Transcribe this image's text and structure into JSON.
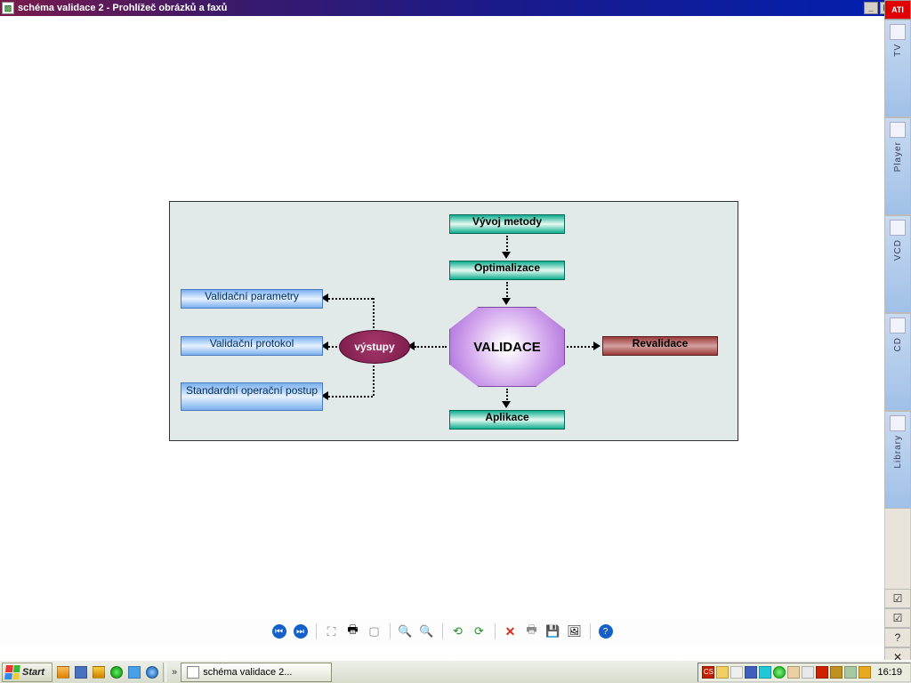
{
  "window": {
    "title": "schéma validace 2 - Prohlížeč obrázků a faxů"
  },
  "ati_sidebar": {
    "logo": "ATI",
    "items": [
      "TV",
      "Player",
      "VCD",
      "CD",
      "Library"
    ],
    "mini": [
      "☑",
      "☑",
      "?",
      "✕"
    ]
  },
  "diagram": {
    "top1": "Vývoj metody",
    "top2": "Optimalizace",
    "center": "VALIDACE",
    "right": "Revalidace",
    "bottom": "Aplikace",
    "ellipse": "výstupy",
    "outputs": [
      "Validační parametry",
      "Validační protokol",
      "Standardní operační postup"
    ]
  },
  "viewer_toolbar": {
    "tips": {
      "prev": "Previous",
      "next": "Next",
      "fit": "Fit",
      "print": "Print",
      "slideshow": "Slideshow",
      "zoomin": "Zoom in",
      "zoomout": "Zoom out",
      "rotl": "Rotate left",
      "rotr": "Rotate right",
      "delete": "Delete",
      "copy": "Copy",
      "save": "Save",
      "open": "Open with",
      "help": "Help"
    }
  },
  "taskbar": {
    "start": "Start",
    "task_label": "schéma validace 2...",
    "clock": "16:19",
    "tray_lang": "CS"
  }
}
